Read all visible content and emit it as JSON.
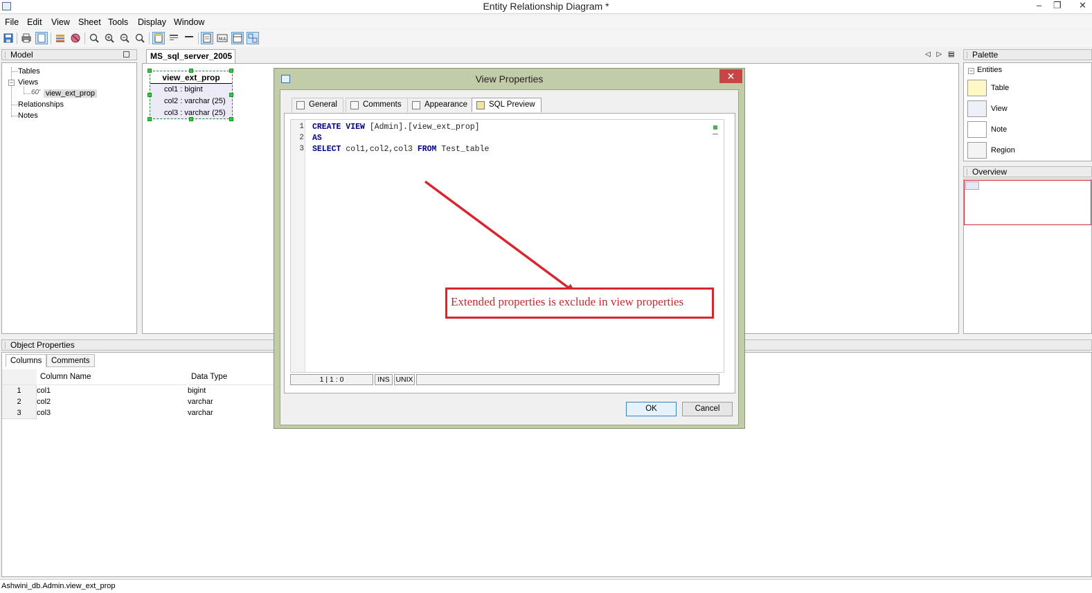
{
  "window": {
    "title": "Entity Relationship Diagram *",
    "minimize_glyph": "–",
    "restore_glyph": "❐",
    "close_glyph": "✕"
  },
  "menu": [
    "File",
    "Edit",
    "View",
    "Sheet",
    "Tools",
    "Display",
    "Window"
  ],
  "toolbar": {
    "icons": [
      "save-icon",
      "print-icon",
      "page-icon",
      "properties-icon",
      "stop-icon",
      "zoom-icon",
      "zoom-in-icon",
      "zoom-out-icon",
      "zoom-fit-icon",
      "table-view-icon",
      "columns-icon",
      "line-icon",
      "diagram-table-icon",
      "null-icon",
      "layout-icon",
      "arrange-icon"
    ]
  },
  "model_panel": {
    "title": "Model",
    "tree": {
      "tables": "Tables",
      "views": "Views",
      "view_item": "view_ext_prop",
      "view_item_icon_glyph": "60'",
      "relationships": "Relationships",
      "notes": "Notes",
      "toggle_glyph": "−"
    }
  },
  "sheet": {
    "tab": "MS_sql_server_2005",
    "nav_prev": "◁",
    "nav_next": "▷",
    "nav_menu": "▤"
  },
  "entity": {
    "name": "view_ext_prop",
    "columns": [
      "col1 : bigint",
      "col2 : varchar (25)",
      "col3 : varchar (25)"
    ]
  },
  "palette": {
    "title": "Palette",
    "section": "Entities",
    "items": [
      "Table",
      "View",
      "Note",
      "Region"
    ],
    "toggle_glyph": "−"
  },
  "overview": {
    "title": "Overview"
  },
  "object_properties": {
    "title": "Object Properties",
    "tabs": [
      "Columns",
      "Comments"
    ],
    "headers": [
      "Column Name",
      "Data Type"
    ],
    "rows": [
      {
        "num": "1",
        "name": "col1",
        "type": "bigint"
      },
      {
        "num": "2",
        "name": "col2",
        "type": "varchar"
      },
      {
        "num": "3",
        "name": "col3",
        "type": "varchar"
      }
    ]
  },
  "status": {
    "path": "Ashwini_db.Admin.view_ext_prop"
  },
  "dialog": {
    "title": "View Properties",
    "close_glyph": "✕",
    "tabs": [
      "General",
      "Comments",
      "Appearance",
      "SQL Preview"
    ],
    "active_tab": "SQL Preview",
    "sql_lines": [
      {
        "num": "1",
        "kw1": "CREATE VIEW",
        "rest": " [Admin].[view_ext_prop]"
      },
      {
        "num": "2",
        "kw1": "AS",
        "rest": ""
      },
      {
        "num": "3",
        "kw1": "SELECT",
        "mid": " col1,col2,col3 ",
        "kw2": "FROM",
        "rest": " Test_table"
      }
    ],
    "editor_status": {
      "position": "1 | 1 : 0",
      "mode": "INS",
      "line_endings": "UNIX"
    },
    "buttons": {
      "ok": "OK",
      "cancel": "Cancel"
    }
  },
  "annotation": {
    "text": "Extended properties is exclude in view properties",
    "color": "#d8262f"
  }
}
